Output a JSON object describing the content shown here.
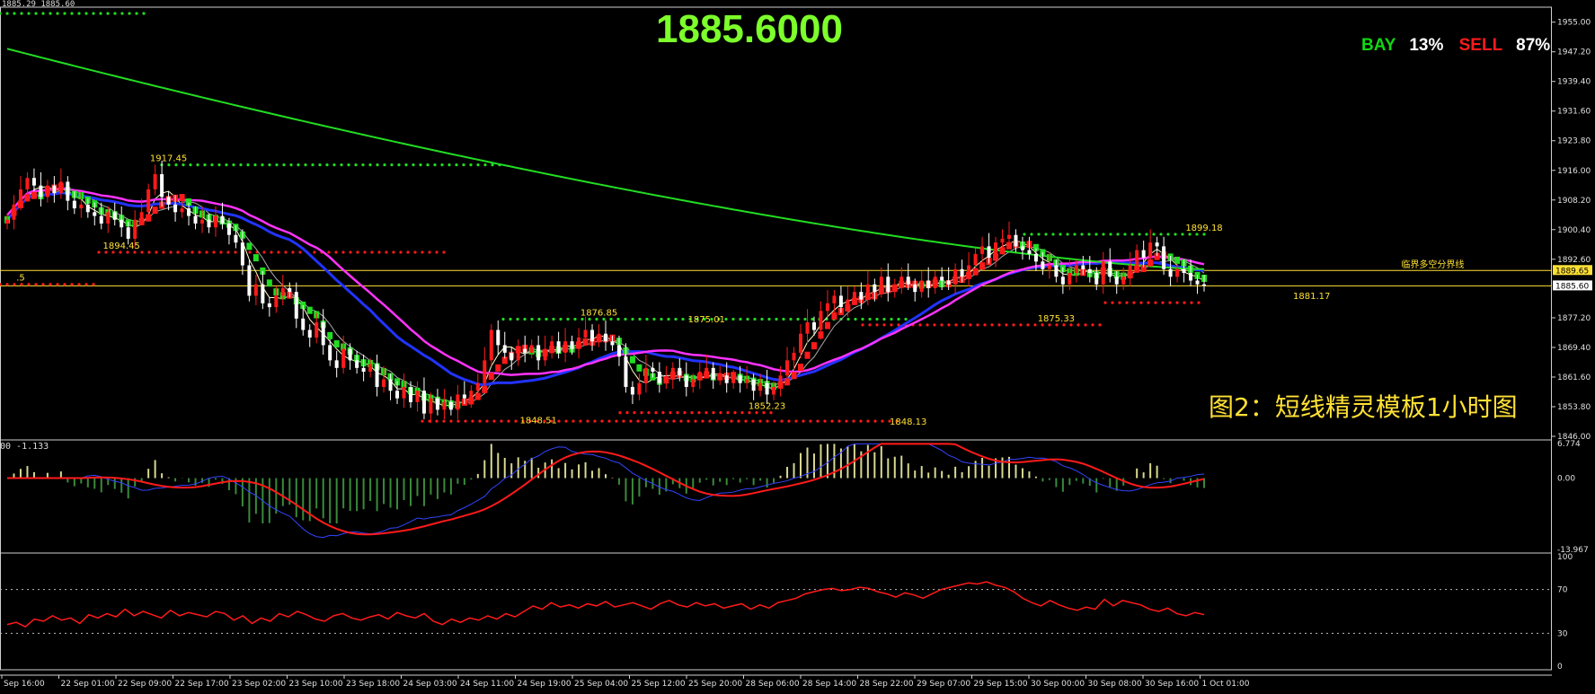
{
  "header": {
    "price": "1885.6000",
    "bay_label": "BAY",
    "bay_pct": "13%",
    "sell_label": "SELL",
    "sell_pct": "87%",
    "topleft_text": "1885.29 1885.60",
    "caption": "图2：短线精灵模板1小时图",
    "macd_text": "00 -1.133"
  },
  "colors": {
    "bull": "#ff1a1a",
    "bear": "#22dd22",
    "green_ma": "#22dd22",
    "magenta_ma": "#ff33ff",
    "blue_ma": "#2233ff",
    "macd_signal": "#ff1a1a",
    "rsi": "#ff1a1a",
    "text_yellow": "#ffe135"
  },
  "chart_data": [
    {
      "type": "candlestick",
      "panel": "price",
      "ylim": [
        1846.0,
        1958.0
      ],
      "y_ticks": [
        "1955.00",
        "1947.20",
        "1939.40",
        "1931.60",
        "1923.80",
        "1916.00",
        "1908.20",
        "1900.40",
        "1892.60",
        "1877.20",
        "1869.40",
        "1861.60",
        "1853.80",
        "1846.00"
      ],
      "price_tags": [
        {
          "value": 1889.65,
          "label": "1889.65",
          "style": "line"
        },
        {
          "value": 1885.6,
          "label": "1885.60",
          "style": "line"
        }
      ],
      "annotations": [
        {
          "x": 24,
          "value": 1917.45,
          "text": "1917.45"
        },
        {
          "x": 17,
          "value": 1894.45,
          "text": "1894.45"
        },
        {
          "x": 88,
          "value": 1876.85,
          "text": "1876.85"
        },
        {
          "x": 104,
          "value": 1875.01,
          "text": "1875.01"
        },
        {
          "x": 79,
          "value": 1848.51,
          "text": "1848.51"
        },
        {
          "x": 113,
          "value": 1852.23,
          "text": "1852.23"
        },
        {
          "x": 134,
          "value": 1848.13,
          "text": "1848.13"
        },
        {
          "x": 178,
          "value": 1899.18,
          "text": "1899.18"
        },
        {
          "x": 156,
          "value": 1875.33,
          "text": "1875.33"
        },
        {
          "x": 194,
          "value": 1881.17,
          "text": "1881.17"
        },
        {
          "x": 2,
          "value": 1886.0,
          "text": ".5"
        },
        {
          "x": 212,
          "value": 1889.5,
          "text": "临界多空分界线"
        }
      ],
      "x_labels": [
        "Sep 16:00",
        "22 Sep 01:00",
        "22 Sep 09:00",
        "22 Sep 17:00",
        "23 Sep 02:00",
        "23 Sep 10:00",
        "23 Sep 18:00",
        "24 Sep 03:00",
        "24 Sep 11:00",
        "24 Sep 19:00",
        "25 Sep 04:00",
        "25 Sep 12:00",
        "25 Sep 20:00",
        "28 Sep 06:00",
        "28 Sep 14:00",
        "28 Sep 22:00",
        "29 Sep 07:00",
        "29 Sep 15:00",
        "30 Sep 00:00",
        "30 Sep 08:00",
        "30 Sep 16:00",
        "1 Oct 01:00"
      ],
      "closes": [
        1903,
        1907,
        1911,
        1914,
        1912,
        1909,
        1912,
        1910,
        1913,
        1908,
        1906,
        1907,
        1905,
        1904,
        1902,
        1905,
        1903,
        1901,
        1898,
        1903,
        1905,
        1911,
        1915,
        1909,
        1907,
        1905,
        1906,
        1904,
        1902,
        1903,
        1901,
        1904,
        1902,
        1899,
        1897,
        1891,
        1883,
        1886,
        1881,
        1880,
        1883,
        1885,
        1884,
        1877,
        1874,
        1872,
        1876,
        1870,
        1866,
        1864,
        1869,
        1866,
        1864,
        1863,
        1865,
        1859,
        1861,
        1858,
        1856,
        1859,
        1855,
        1858,
        1852,
        1856,
        1853,
        1855,
        1853,
        1857,
        1856,
        1858,
        1860,
        1866,
        1874,
        1870,
        1868,
        1866,
        1869,
        1868,
        1870,
        1866,
        1869,
        1871,
        1868,
        1871,
        1869,
        1872,
        1874,
        1871,
        1873,
        1871,
        1870,
        1867,
        1859,
        1857,
        1860,
        1864,
        1863,
        1860,
        1861,
        1864,
        1862,
        1859,
        1861,
        1863,
        1864,
        1861,
        1862,
        1860,
        1862,
        1860,
        1861,
        1858,
        1860,
        1857,
        1859,
        1862,
        1866,
        1868,
        1873,
        1876,
        1874,
        1879,
        1881,
        1883,
        1880,
        1882,
        1884,
        1882,
        1886,
        1884,
        1888,
        1884,
        1886,
        1888,
        1886,
        1884,
        1887,
        1885,
        1888,
        1887,
        1886,
        1890,
        1888,
        1891,
        1894,
        1896,
        1893,
        1897,
        1898,
        1899,
        1896,
        1895,
        1894,
        1892,
        1890,
        1891,
        1888,
        1886,
        1889,
        1891,
        1890,
        1889,
        1886,
        1892,
        1888,
        1886,
        1888,
        1891,
        1895,
        1893,
        1897,
        1896,
        1890,
        1888,
        1890,
        1889,
        1887,
        1886,
        1885.6
      ],
      "ma_green_start": 1948,
      "ma_green_end": 1890,
      "legend": []
    },
    {
      "type": "histogram+line",
      "panel": "macd",
      "ylim": [
        -13.967,
        6.774
      ],
      "y_ticks": [
        "6.774",
        "0.00",
        "-13.967"
      ]
    },
    {
      "type": "line",
      "panel": "rsi",
      "ylim": [
        0,
        100
      ],
      "y_ticks": [
        "100",
        "70",
        "30",
        "0"
      ],
      "levels": [
        70,
        30
      ],
      "values": [
        38,
        40,
        36,
        43,
        41,
        46,
        42,
        44,
        39,
        47,
        44,
        48,
        45,
        52,
        46,
        50,
        47,
        44,
        51,
        46,
        49,
        47,
        45,
        50,
        48,
        42,
        46,
        39,
        44,
        41,
        48,
        45,
        50,
        47,
        43,
        41,
        46,
        48,
        44,
        42,
        45,
        47,
        43,
        49,
        46,
        44,
        48,
        41,
        38,
        43,
        40,
        44,
        42,
        46,
        43,
        48,
        45,
        50,
        55,
        52,
        58,
        54,
        56,
        53,
        57,
        55,
        59,
        54,
        56,
        58,
        55,
        52,
        57,
        60,
        56,
        54,
        58,
        55,
        57,
        53,
        55,
        57,
        52,
        56,
        53,
        58,
        60,
        62,
        66,
        68,
        70,
        71,
        69,
        70,
        72,
        71,
        68,
        66,
        63,
        67,
        65,
        62,
        66,
        70,
        72,
        74,
        76,
        75,
        77,
        74,
        72,
        68,
        62,
        58,
        55,
        60,
        56,
        53,
        51,
        54,
        52,
        61,
        55,
        60,
        58,
        56,
        52,
        50,
        53,
        48,
        46,
        49,
        47
      ]
    }
  ]
}
